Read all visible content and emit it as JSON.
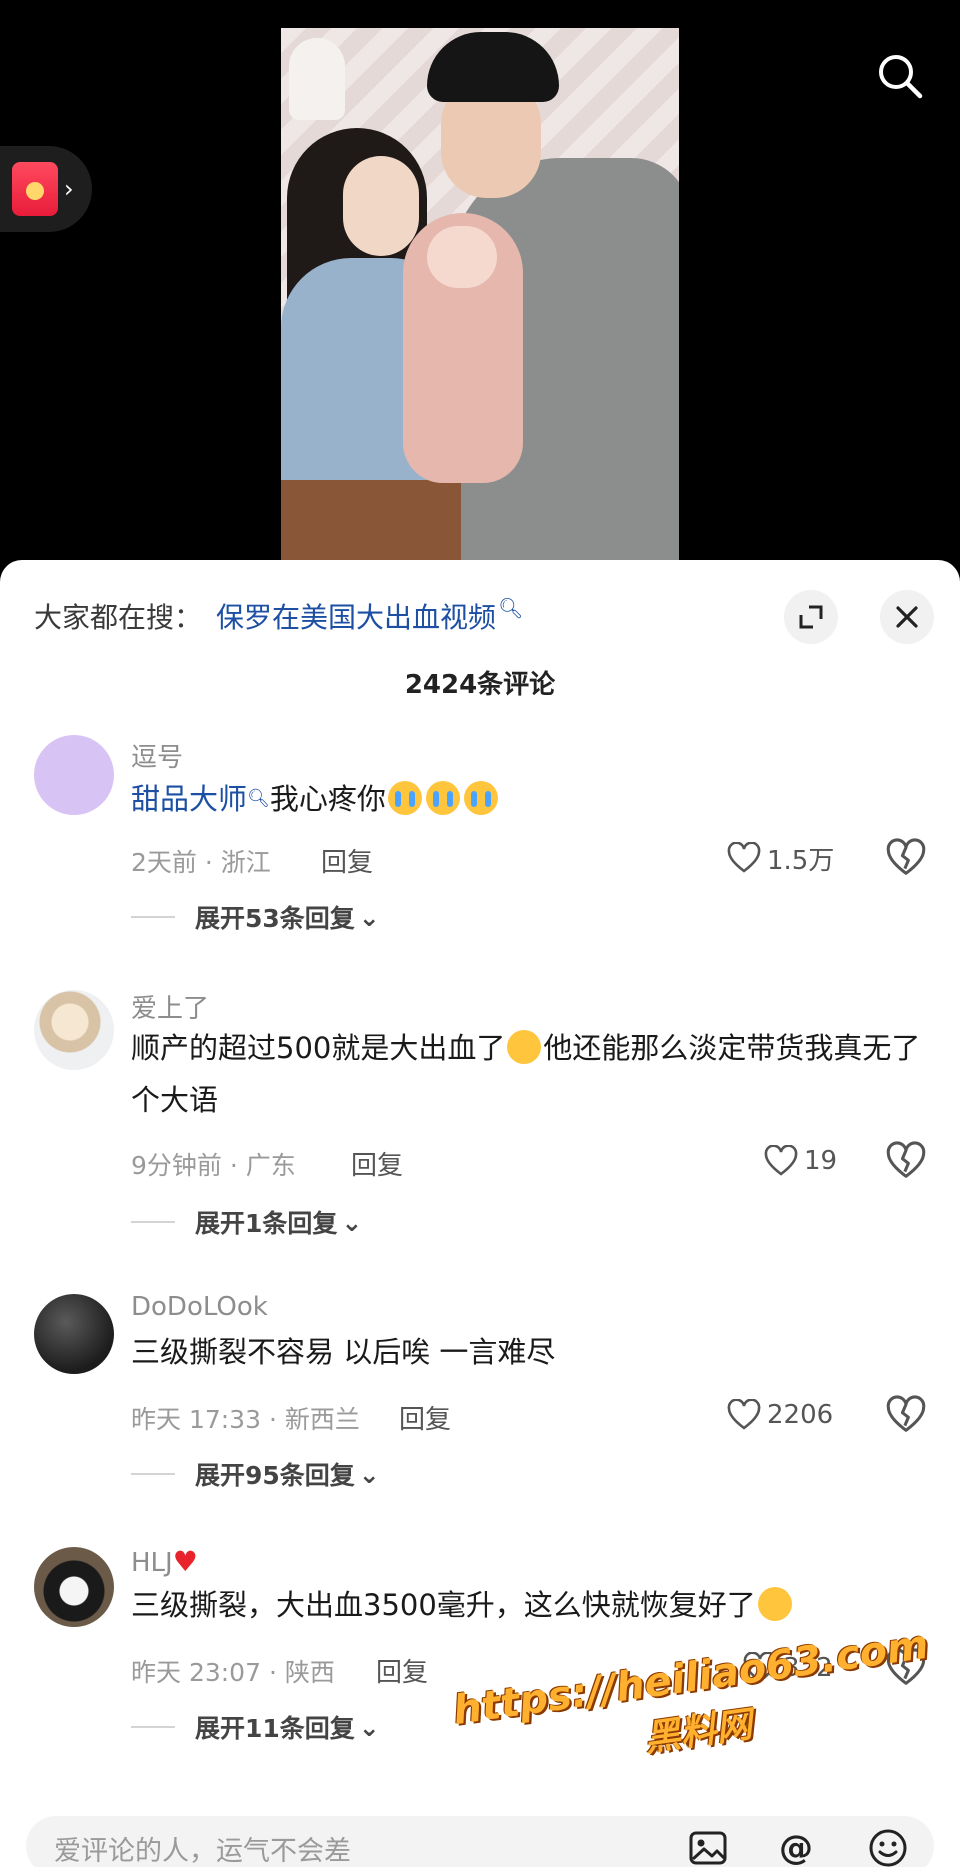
{
  "hot_search": {
    "prefix": "大家都在搜：",
    "query": "保罗在美国大出血视频"
  },
  "comment_count": "2424条评论",
  "comments": [
    {
      "username": "逗号",
      "mention": "甜品大师",
      "text": "我心疼你",
      "time_location": "2天前 · 浙江",
      "reply_label": "回复",
      "likes": "1.5万",
      "expand_label": "展开53条回复",
      "avatar_color": "#d8c3f5"
    },
    {
      "username": "爱上了",
      "text": "顺产的超过500就是大出血了",
      "text_after": "他还能那么淡定带货我真无了个大语",
      "time_location": "9分钟前 · 广东",
      "reply_label": "回复",
      "likes": "19",
      "expand_label": "展开1条回复"
    },
    {
      "username": "DoDoLOok",
      "text": "三级撕裂不容易 以后唉 一言难尽",
      "time_location": "昨天 17:33 · 新西兰",
      "reply_label": "回复",
      "likes": "2206",
      "expand_label": "展开95条回复"
    },
    {
      "username": "HLJ",
      "text": "三级撕裂，大出血3500毫升，这么快就恢复好了",
      "time_location": "昨天 23:07 · 陕西",
      "reply_label": "回复",
      "likes": "322",
      "expand_label": "展开11条回复"
    }
  ],
  "input_placeholder": "爱评论的人，运气不会差",
  "watermark": {
    "url": "https://heiliao63.com",
    "name": "黑料网"
  },
  "colors": {
    "link": "#1d4fa3",
    "watermark": "#ffb02e",
    "background": "#000000"
  }
}
